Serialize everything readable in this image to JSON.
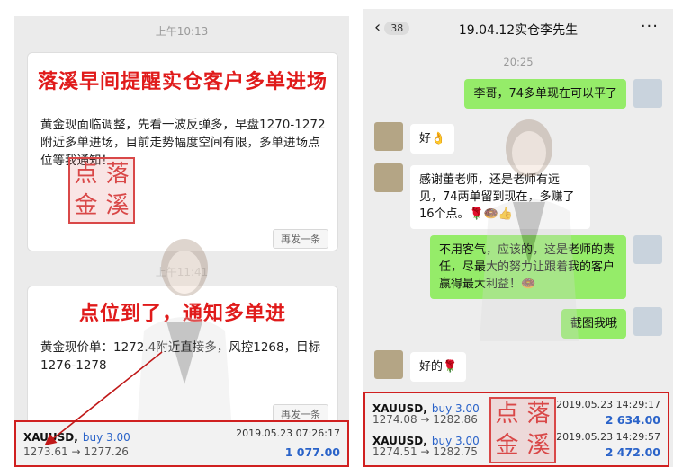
{
  "left": {
    "time": "上午10:13",
    "ghost_time": "上午11:41",
    "card1": {
      "title": "落溪早间提醒实仓客户多单进场",
      "text": "黄金现面临调整，先看一波反弹多，早盘1270-1272附近多单进场，目前走势幅度空间有限，多单进场点位等我通知！",
      "resend": "再发一条"
    },
    "card2": {
      "title": "点位到了，通知多单进",
      "text": "黄金现价单：1272.4附近直接多，风控1268，目标1276-1278",
      "resend": "再发一条"
    },
    "trade": {
      "symbol": "XAUUSD,",
      "side": "buy 3.00",
      "date": "2019.05.23 07:26:17",
      "prices": "1273.61 → 1277.26",
      "profit": "1 077.00"
    }
  },
  "seal": {
    "chars": [
      "点",
      "落",
      "金",
      "溪"
    ],
    "color": "#d94848"
  },
  "right": {
    "header": {
      "back_icon": "chevron-left",
      "unread": "38",
      "title": "19.04.12实仓李先生",
      "more": "···"
    },
    "time": "20:25",
    "messages": [
      {
        "from": "me",
        "text": "李哥，74多单现在可以平了"
      },
      {
        "from": "other",
        "text": "好👌"
      },
      {
        "from": "other",
        "text": "感谢董老师，还是老师有远见，74两单留到现在，多赚了16个点。🌹🍩👍"
      },
      {
        "from": "me",
        "text": "不用客气，应该的，这是老师的责任，尽最大的努力让跟着我的客户赢得最大利益！🍩"
      },
      {
        "from": "me",
        "text": "截图我哦"
      },
      {
        "from": "other",
        "text": "好的🌹"
      }
    ],
    "trades": [
      {
        "symbol": "XAUUSD,",
        "side": "buy 3.00",
        "date": "2019.05.23 14:29:17",
        "prices": "1274.08 → 1282.86",
        "profit": "2 634.00"
      },
      {
        "symbol": "XAUUSD,",
        "side": "buy 3.00",
        "date": "2019.05.23 14:29:57",
        "prices": "1274.51 → 1282.75",
        "profit": "2 472.00"
      }
    ]
  },
  "colors": {
    "accent_red": "#e01b1b",
    "wechat_green": "#95ec69",
    "profit_blue": "#2a63c9"
  }
}
